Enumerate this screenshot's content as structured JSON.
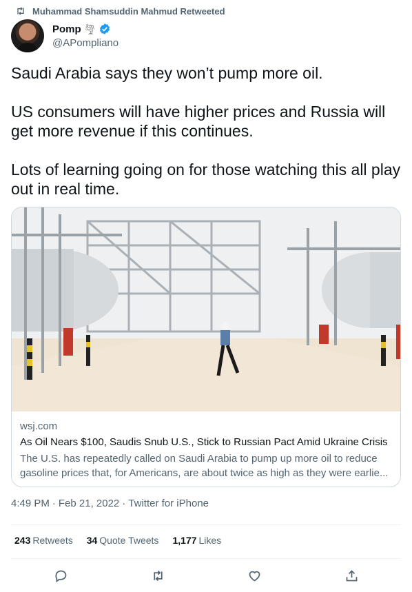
{
  "retweet": {
    "label": "Muhammad Shamsuddin Mahmud Retweeted"
  },
  "author": {
    "name": "Pomp",
    "handle": "@APompliano",
    "tornado_emoji": "🌪"
  },
  "tweet": {
    "paragraphs": [
      "Saudi Arabia says they won’t pump more oil.",
      "US consumers will have higher prices and Russia will get more revenue if this continues.",
      "Lots of learning going on for those watching this all play out in real time."
    ]
  },
  "card": {
    "domain": "wsj.com",
    "title": "As Oil Nears $100, Saudis Snub U.S., Stick to Russian Pact Amid Ukraine Crisis",
    "description": "The U.S. has repeatedly called on Saudi Arabia to pump up more oil to reduce gasoline prices that, for Americans, are about twice as high as they were earlie..."
  },
  "meta": {
    "time": "4:49 PM",
    "date": "Feb 21, 2022",
    "source": "Twitter for iPhone",
    "separator": "·"
  },
  "stats": {
    "retweets_count": "243",
    "retweets_label": "Retweets",
    "quotes_count": "34",
    "quotes_label": "Quote Tweets",
    "likes_count": "1,177",
    "likes_label": "Likes"
  },
  "colors": {
    "text": "#0f1419",
    "secondary": "#536471",
    "verified": "#1d9bf0",
    "border": "#cfd9de"
  },
  "icons": [
    "retweet-icon",
    "verified-badge-icon",
    "reply-icon",
    "retweet-icon",
    "like-icon",
    "share-icon"
  ]
}
